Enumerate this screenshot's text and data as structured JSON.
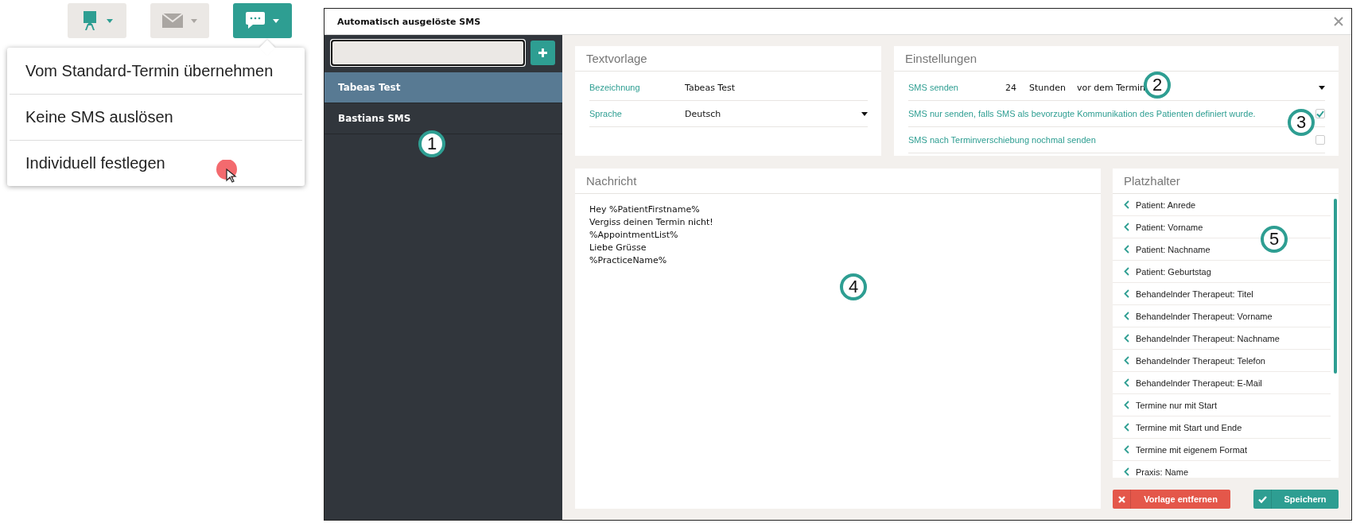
{
  "toolbar": {
    "buttons": [
      {
        "kind": "easel",
        "selected": false,
        "disabled": false
      },
      {
        "kind": "mail",
        "selected": false,
        "disabled": true
      },
      {
        "kind": "chat",
        "selected": true,
        "disabled": false
      }
    ]
  },
  "menu": {
    "items": [
      "Vom Standard-Termin übernehmen",
      "Keine SMS auslösen",
      "Individuell festlegen"
    ]
  },
  "dialog": {
    "title": "Automatisch ausgelöste SMS",
    "sidebar": {
      "items": [
        {
          "label": "Tabeas Test",
          "selected": true
        },
        {
          "label": "Bastians SMS",
          "selected": false
        }
      ]
    },
    "template": {
      "heading": "Textvorlage",
      "fields": [
        {
          "kind": "text",
          "label": "Bezeichnung",
          "value": "Tabeas Test"
        },
        {
          "kind": "select",
          "label": "Sprache",
          "value": "Deutsch"
        }
      ]
    },
    "settings": {
      "heading": "Einstellungen",
      "send": {
        "label": "SMS senden",
        "amount": "24",
        "unit": "Stunden",
        "timing": "vor dem Termin"
      },
      "options": [
        {
          "label": "SMS nur senden, falls SMS als bevorzugte Kommunikation des Patienten definiert wurde.",
          "checked": true
        },
        {
          "label": "SMS nach Terminverschiebung nochmal senden",
          "checked": false
        }
      ]
    },
    "message": {
      "heading": "Nachricht",
      "lines": [
        "Hey %PatientFirstname%",
        "Vergiss deinen Termin nicht!",
        "%AppointmentList%",
        "Liebe Grüsse",
        "%PracticeName%"
      ]
    },
    "placeholders": {
      "heading": "Platzhalter",
      "items": [
        "Patient: Anrede",
        "Patient: Vorname",
        "Patient: Nachname",
        "Patient: Geburtstag",
        "Behandelnder Therapeut: Titel",
        "Behandelnder Therapeut: Vorname",
        "Behandelnder Therapeut: Nachname",
        "Behandelnder Therapeut: Telefon",
        "Behandelnder Therapeut: E-Mail",
        "Termine nur mit Start",
        "Termine mit Start und Ende",
        "Termine mit eigenem Format",
        "Praxis: Name"
      ]
    },
    "buttons": [
      {
        "kind": "danger",
        "label": "Vorlage entfernen"
      },
      {
        "kind": "primary",
        "label": "Speichern"
      }
    ]
  },
  "callouts": [
    "1",
    "2",
    "3",
    "4",
    "5"
  ]
}
